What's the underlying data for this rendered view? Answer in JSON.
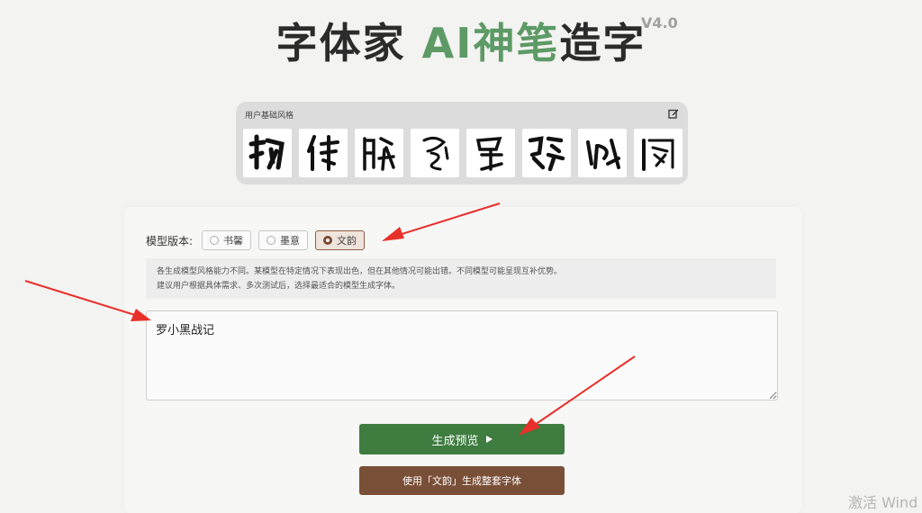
{
  "header": {
    "title_part1": "字体家 ",
    "title_highlight": "AI神笔",
    "title_part2": "造字",
    "version": "V4.0"
  },
  "style_panel": {
    "label": "用户基础风格",
    "glyph_count": 8
  },
  "model": {
    "label": "模型版本:",
    "options": [
      "书馨",
      "墨意",
      "文韵"
    ],
    "selected": "文韵"
  },
  "note": {
    "line1": "各生成模型风格能力不同。某模型在特定情况下表现出色，但在其他情况可能出错。不同模型可能呈现互补优势。",
    "line2": "建议用户根据具体需求、多次测试后，选择最适合的模型生成字体。"
  },
  "input": {
    "value": "罗小黑战记"
  },
  "buttons": {
    "preview": "生成预览",
    "generate_full": "使用「文韵」生成整套字体"
  },
  "watermark": "激活 Wind",
  "colors": {
    "accent_green": "#3e7c3f",
    "accent_brown": "#7a4f37",
    "title_highlight": "#5d9a66",
    "annotation_red": "#e8302a"
  }
}
